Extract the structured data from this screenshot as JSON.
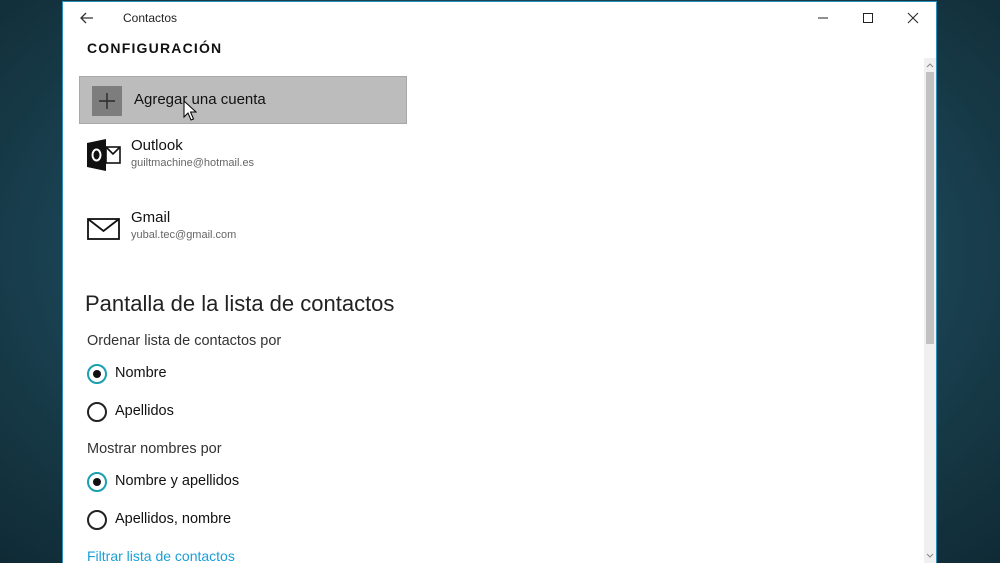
{
  "window": {
    "title": "Contactos"
  },
  "header": {
    "title": "CONFIGURACIÓN"
  },
  "add_account": {
    "label": "Agregar una cuenta"
  },
  "accounts": [
    {
      "name": "Outlook",
      "email": "guiltmachine@hotmail.es",
      "icon": "outlook-icon"
    },
    {
      "name": "Gmail",
      "email": "yubal.tec@gmail.com",
      "icon": "mail-icon"
    }
  ],
  "contact_list": {
    "title": "Pantalla de la lista de contactos",
    "sort_label": "Ordenar lista de contactos por",
    "sort_options": [
      {
        "label": "Nombre",
        "checked": true
      },
      {
        "label": "Apellidos",
        "checked": false
      }
    ],
    "display_label": "Mostrar nombres por",
    "display_options": [
      {
        "label": "Nombre y apellidos",
        "checked": true
      },
      {
        "label": "Apellidos, nombre",
        "checked": false
      }
    ],
    "filter_link": "Filtrar lista de contactos"
  },
  "colors": {
    "accent": "#1a9fb0",
    "link": "#1a9fd9",
    "selected_bg": "#bcbcbc"
  }
}
